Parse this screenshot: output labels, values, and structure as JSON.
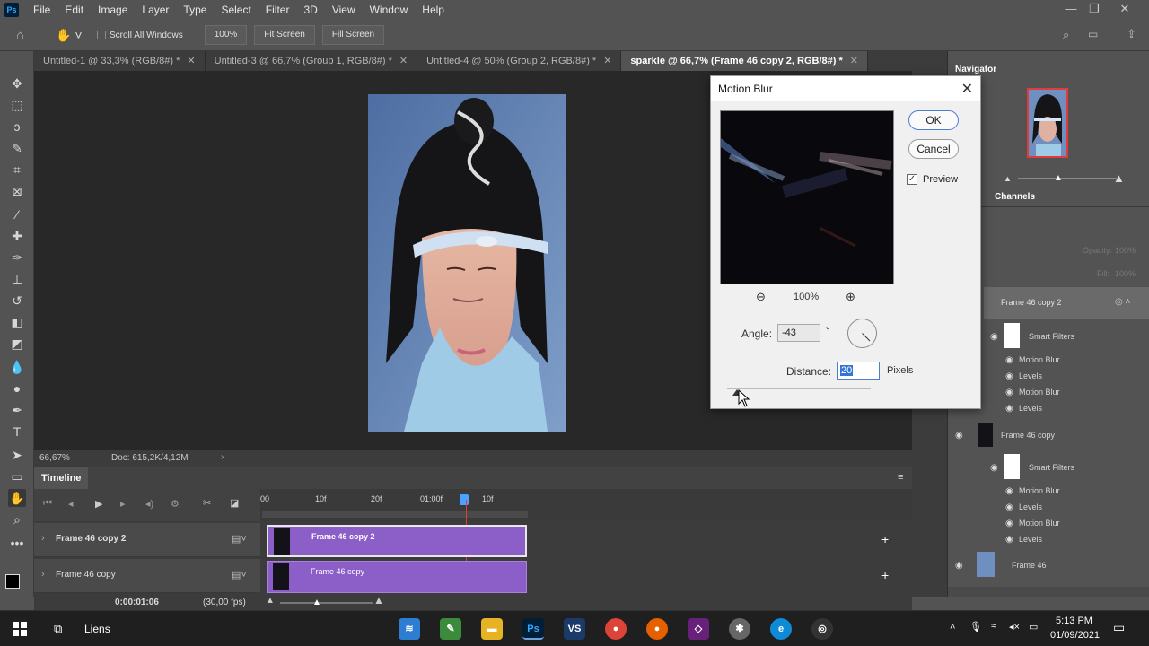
{
  "app": {
    "logo": "Ps"
  },
  "menu": [
    "File",
    "Edit",
    "Image",
    "Layer",
    "Type",
    "Select",
    "Filter",
    "3D",
    "View",
    "Window",
    "Help"
  ],
  "options": {
    "scroll_all": "Scroll All Windows",
    "zoom": "100%",
    "fit_screen": "Fit Screen",
    "fill_screen": "Fill Screen"
  },
  "tabs": [
    {
      "label": "Untitled-1 @ 33,3% (RGB/8#) *"
    },
    {
      "label": "Untitled-3 @ 66,7% (Group 1, RGB/8#) *"
    },
    {
      "label": "Untitled-4 @ 50% (Group 2, RGB/8#) *"
    },
    {
      "label": "sparkle @ 66,7% (Frame 46 copy 2, RGB/8#) *"
    }
  ],
  "status": {
    "zoom": "66,67%",
    "doc": "Doc: 615,2K/4,12M"
  },
  "timeline": {
    "title": "Timeline",
    "ruler": [
      "00",
      "10f",
      "20f",
      "01:00f",
      "10f"
    ],
    "tracks": [
      {
        "label": "Frame 46 copy 2",
        "clip": "Frame 46 copy 2"
      },
      {
        "label": "Frame 46 copy",
        "clip": "Frame 46 copy"
      }
    ],
    "time": "0:00:01:06",
    "fps": "(30,00 fps)"
  },
  "dialog": {
    "title": "Motion Blur",
    "ok": "OK",
    "cancel": "Cancel",
    "preview_label": "Preview",
    "zoom": "100%",
    "angle_label": "Angle:",
    "angle_value": "-43",
    "degree": "°",
    "distance_label": "Distance:",
    "distance_value": "20",
    "pixels": "Pixels",
    "distance_fraction": 0.07
  },
  "panels": {
    "navigator": "Navigator",
    "channels": "Channels",
    "opacity_label": "Opacity:",
    "opacity_value": "100%",
    "fill_label": "Fill:",
    "fill_value": "100%"
  },
  "layers": [
    {
      "name": "Frame 46 copy 2",
      "fx": [
        "Smart Filters",
        "Motion Blur",
        "Levels",
        "Motion Blur",
        "Levels"
      ]
    },
    {
      "name": "Frame 46 copy",
      "fx": [
        "Smart Filters",
        "Motion Blur",
        "Levels",
        "Motion Blur",
        "Levels"
      ]
    },
    {
      "name": "Frame 46"
    }
  ],
  "taskbar": {
    "search": "Liens",
    "time": "5:13 PM",
    "date": "01/09/2021"
  }
}
